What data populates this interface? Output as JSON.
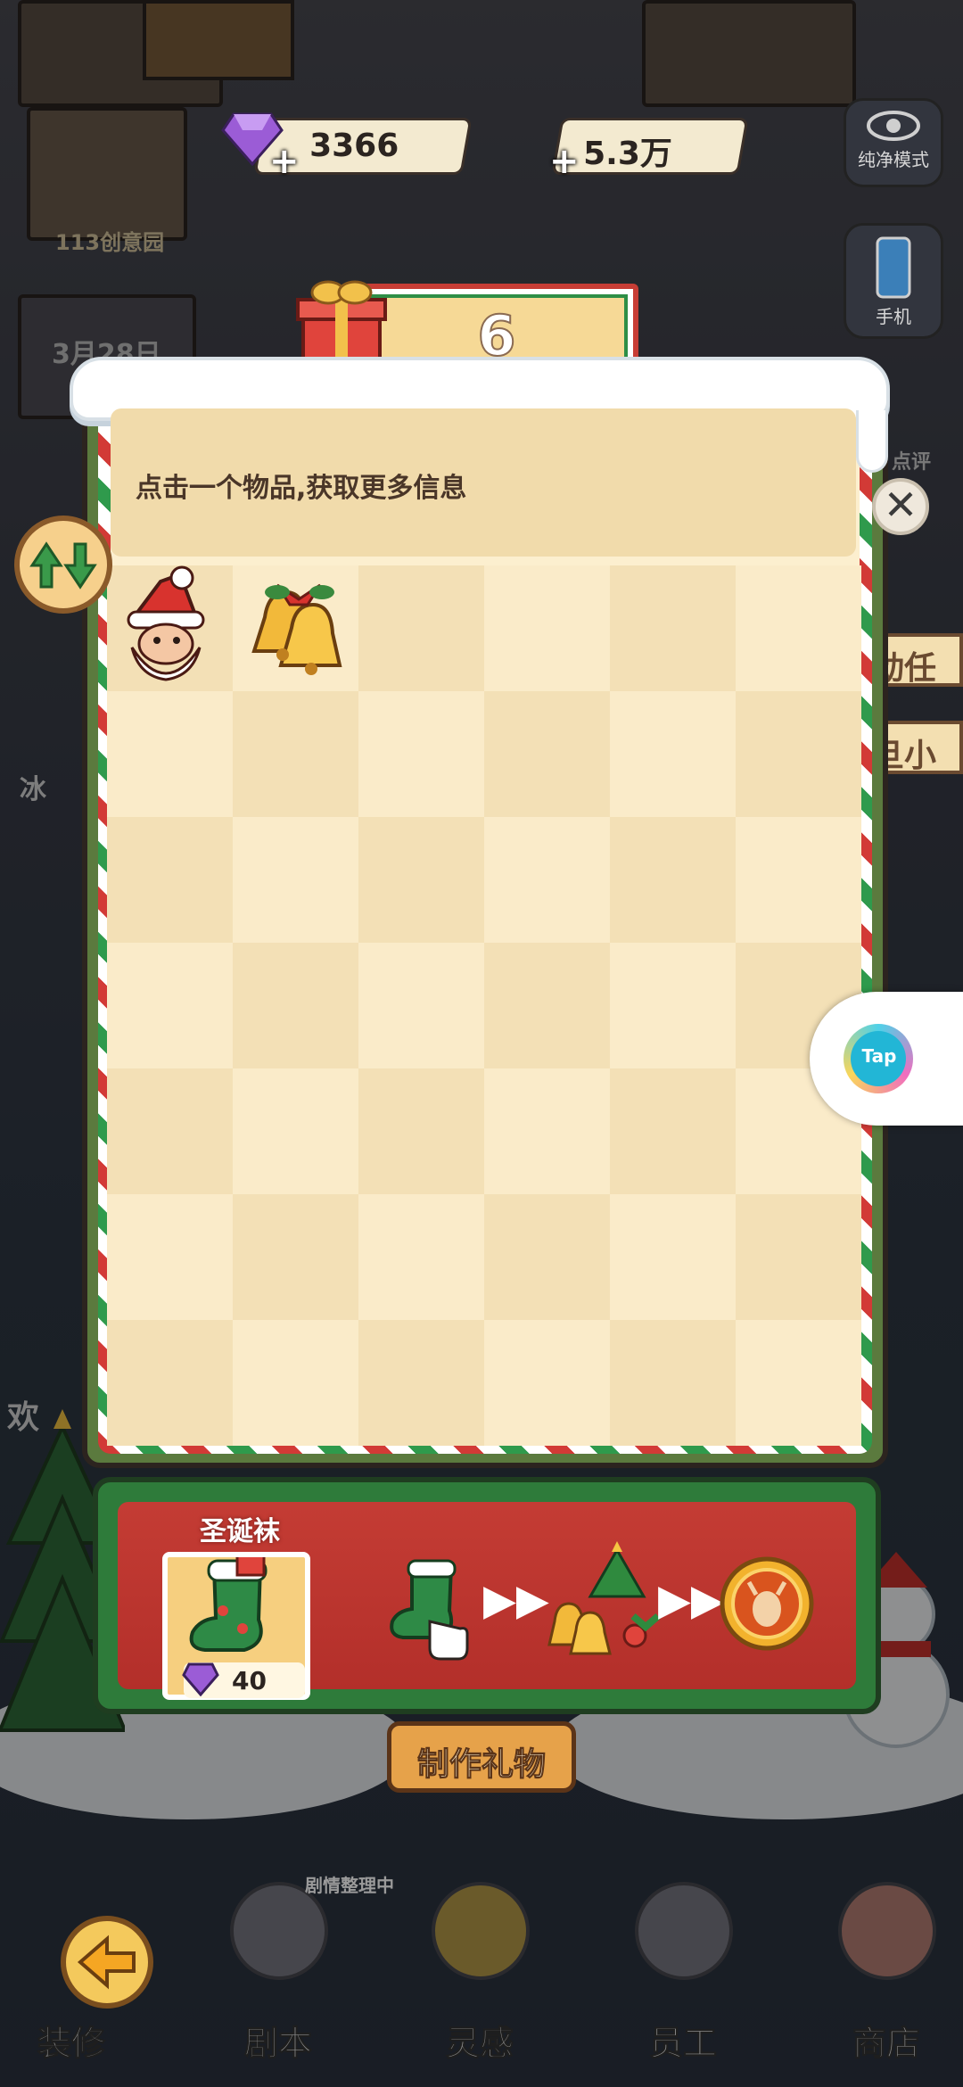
{
  "resources": {
    "gems": "3366",
    "cash": "5.3万",
    "pure_mode": "纯净模式",
    "phone": "手机"
  },
  "background": {
    "studio_sign": "113创意园",
    "date": "3月28日",
    "side_tasks": "动任务",
    "side_shop": "旦小店",
    "left_clip": "冰",
    "left_clip2": "欢",
    "review": "点评"
  },
  "counter": {
    "value": "6"
  },
  "panel": {
    "info_text": "点击一个物品,获取更多信息",
    "items": [
      {
        "name": "santa-head",
        "col": 0,
        "row": 0
      },
      {
        "name": "golden-bells",
        "col": 1,
        "row": 0
      }
    ]
  },
  "banner": {
    "title": "圣诞袜",
    "price": "40"
  },
  "make_gift": "制作礼物",
  "nav": {
    "decorate": "装修",
    "script": "剧本",
    "inspiration": "灵感",
    "staff": "员工",
    "shop": "商店",
    "script_status": "剧情整理中"
  },
  "tap": "Tap",
  "colors": {
    "panel_bg": "#fcefcf",
    "cell_a": "#f3e0b6",
    "cell_b": "#faebc9",
    "banner_red": "#c43c34",
    "stripe_red": "#d23a36",
    "stripe_green": "#2f9a4c"
  }
}
